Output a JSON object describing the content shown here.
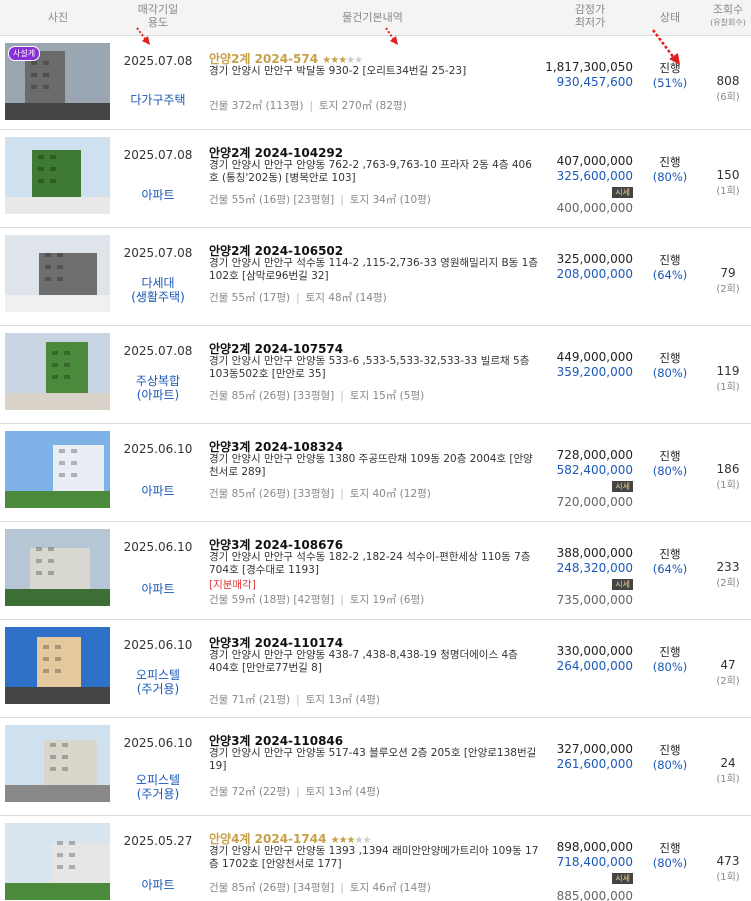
{
  "header": {
    "photo": "사진",
    "date_line1": "매각기일",
    "date_line2": "용도",
    "basic": "물건기본내역",
    "price_line1": "감정가",
    "price_line2": "최저가",
    "status": "상태",
    "views_line1": "조회수",
    "views_line2": "(유찰회수)"
  },
  "colors": {
    "link_blue": "#1a58b8",
    "gold_title": "#c8a049",
    "badge_purple": "#8b2fd6",
    "arrow_red": "#e02020"
  },
  "market_label": "시세",
  "rows": [
    {
      "badge": "사설게",
      "date": "2025.07.08",
      "usage1": "다가구주택",
      "usage2": "",
      "title": "안양2계 2024-574",
      "stars": "★★★",
      "stars_off": "★★",
      "addr": "경기 안양시 만안구 박달동 930-2 [오리트34번길 25-23]",
      "note": "",
      "bld": "건물 372㎡ (113평)",
      "land": "토지 270㎡ (82평)",
      "appraisal": "1,817,300,050",
      "min": "930,457,600",
      "market_value": "",
      "status": "진행",
      "pct": "(51%)",
      "views": "808",
      "fails": "(6회)"
    },
    {
      "badge": "",
      "date": "2025.07.08",
      "usage1": "아파트",
      "usage2": "",
      "title": "안양2계 2024-104292",
      "stars": "",
      "stars_off": "",
      "addr": "경기 안양시 만안구 안양동 762-2 ,763-9,763-10 프라자 2동 4층 406호 (통칭'202동) [병목안로 103]",
      "note": "",
      "bld": "건물 55㎡ (16평) [23평형]",
      "land": "토지 34㎡ (10평)",
      "appraisal": "407,000,000",
      "min": "325,600,000",
      "market_value": "400,000,000",
      "status": "진행",
      "pct": "(80%)",
      "views": "150",
      "fails": "(1회)"
    },
    {
      "badge": "",
      "date": "2025.07.08",
      "usage1": "다세대",
      "usage2": "(생활주택)",
      "title": "안양2계 2024-106502",
      "stars": "",
      "stars_off": "",
      "addr": "경기 안양시 만안구 석수동 114-2 ,115-2,736-33 영원해밀리지 B동 1층 102호 [삼막로96번길 32]",
      "note": "",
      "bld": "건물 55㎡ (17평)",
      "land": "토지 48㎡ (14평)",
      "appraisal": "325,000,000",
      "min": "208,000,000",
      "market_value": "",
      "status": "진행",
      "pct": "(64%)",
      "views": "79",
      "fails": "(2회)"
    },
    {
      "badge": "",
      "date": "2025.07.08",
      "usage1": "주상복합",
      "usage2": "(아파트)",
      "title": "안양2계 2024-107574",
      "stars": "",
      "stars_off": "",
      "addr": "경기 안양시 만안구 안양동 533-6 ,533-5,533-32,533-33 빌르채 5층 103동502호 [만안로 35]",
      "note": "",
      "bld": "건물 85㎡ (26평) [33평형]",
      "land": "토지 15㎡ (5평)",
      "appraisal": "449,000,000",
      "min": "359,200,000",
      "market_value": "",
      "status": "진행",
      "pct": "(80%)",
      "views": "119",
      "fails": "(1회)"
    },
    {
      "badge": "",
      "date": "2025.06.10",
      "usage1": "아파트",
      "usage2": "",
      "title": "안양3계 2024-108324",
      "stars": "",
      "stars_off": "",
      "addr": "경기 안양시 만안구 안양동 1380 주공뜨란채 109동 20층 2004호 [안양천서로 289]",
      "note": "",
      "bld": "건물 85㎡ (26평) [33평형]",
      "land": "토지 40㎡ (12평)",
      "appraisal": "728,000,000",
      "min": "582,400,000",
      "market_value": "720,000,000",
      "status": "진행",
      "pct": "(80%)",
      "views": "186",
      "fails": "(1회)"
    },
    {
      "badge": "",
      "date": "2025.06.10",
      "usage1": "아파트",
      "usage2": "",
      "title": "안양3계 2024-108676",
      "stars": "",
      "stars_off": "",
      "addr": "경기 안양시 만안구 석수동 182-2 ,182-24 석수이-편한세상 110동 7층 704호 [경수대로 1193]",
      "note": "[지분매각]",
      "bld": "건물 59㎡ (18평) [42평형]",
      "land": "토지 19㎡ (6평)",
      "appraisal": "388,000,000",
      "min": "248,320,000",
      "market_value": "735,000,000",
      "status": "진행",
      "pct": "(64%)",
      "views": "233",
      "fails": "(2회)"
    },
    {
      "badge": "",
      "date": "2025.06.10",
      "usage1": "오피스텔",
      "usage2": "(주거용)",
      "title": "안양3계 2024-110174",
      "stars": "",
      "stars_off": "",
      "addr": "경기 안양시 만안구 안양동 438-7 ,438-8,438-19 청명더에이스 4층 404호 [만안로77번길 8]",
      "note": "",
      "bld": "건물 71㎡ (21평)",
      "land": "토지 13㎡ (4평)",
      "appraisal": "330,000,000",
      "min": "264,000,000",
      "market_value": "",
      "status": "진행",
      "pct": "(80%)",
      "views": "47",
      "fails": "(2회)"
    },
    {
      "badge": "",
      "date": "2025.06.10",
      "usage1": "오피스텔",
      "usage2": "(주거용)",
      "title": "안양3계 2024-110846",
      "stars": "",
      "stars_off": "",
      "addr": "경기 안양시 만안구 안양동 517-43 블루오션 2층 205호 [안양로138번길 19]",
      "note": "",
      "bld": "건물 72㎡ (22평)",
      "land": "토지 13㎡ (4평)",
      "appraisal": "327,000,000",
      "min": "261,600,000",
      "market_value": "",
      "status": "진행",
      "pct": "(80%)",
      "views": "24",
      "fails": "(1회)"
    },
    {
      "badge": "",
      "date": "2025.05.27",
      "usage1": "아파트",
      "usage2": "",
      "title": "안양4계 2024-1744",
      "stars": "★★★",
      "stars_off": "★★",
      "addr": "경기 안양시 만안구 안양동 1393 ,1394 래미안안양메가트리아 109동 17층 1702호 [안양천서로 177]",
      "note": "",
      "bld": "건물 85㎡ (26평) [34평형]",
      "land": "토지 46㎡ (14평)",
      "appraisal": "898,000,000",
      "min": "718,400,000",
      "market_value": "885,000,000",
      "status": "진행",
      "pct": "(80%)",
      "views": "473",
      "fails": "(1회)"
    }
  ]
}
